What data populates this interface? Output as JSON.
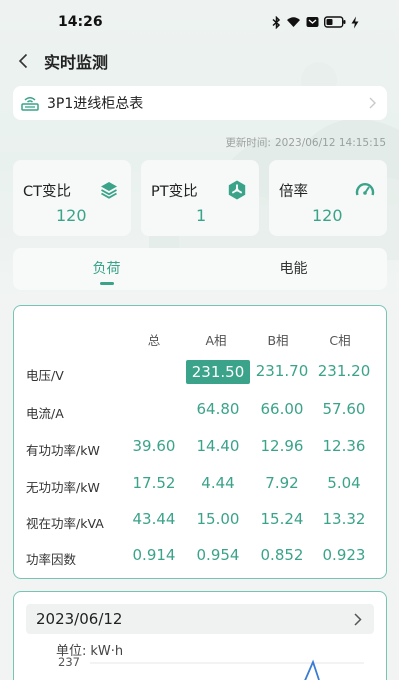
{
  "status_bar": {
    "time": "14:26",
    "icons": [
      "bluetooth-icon",
      "wifi-icon",
      "notification-icon",
      "battery-icon",
      "charging-icon"
    ]
  },
  "header": {
    "title": "实时监测"
  },
  "device": {
    "name": "3P1进线柜总表"
  },
  "update": {
    "label": "更新时间:",
    "value": "2023/06/12 14:15:15"
  },
  "ratios": [
    {
      "label": "CT变比",
      "value": "120",
      "icon": "layers-icon"
    },
    {
      "label": "PT变比",
      "value": "1",
      "icon": "fan-icon"
    },
    {
      "label": "倍率",
      "value": "120",
      "icon": "gauge-icon"
    }
  ],
  "tabs": [
    {
      "label": "负荷",
      "active": true
    },
    {
      "label": "电能",
      "active": false
    }
  ],
  "table": {
    "columns": [
      "总",
      "A相",
      "B相",
      "C相"
    ],
    "rows": [
      {
        "label": "电压/V",
        "values": [
          "",
          "231.50",
          "231.70",
          "231.20"
        ]
      },
      {
        "label": "电流/A",
        "values": [
          "",
          "64.80",
          "66.00",
          "57.60"
        ]
      },
      {
        "label": "有功功率/kW",
        "values": [
          "39.60",
          "14.40",
          "12.96",
          "12.36"
        ]
      },
      {
        "label": "无功功率/kW",
        "values": [
          "17.52",
          "4.44",
          "7.92",
          "5.04"
        ]
      },
      {
        "label": "视在功率/kVA",
        "values": [
          "43.44",
          "15.00",
          "15.24",
          "13.32"
        ]
      },
      {
        "label": "功率因数",
        "values": [
          "0.914",
          "0.954",
          "0.852",
          "0.923"
        ]
      }
    ],
    "highlighted_cell": "231.50"
  },
  "energy": {
    "date": "2023/06/12",
    "unit_label": "单位:",
    "unit_value": "kW·h",
    "y_top_tick": "237"
  },
  "colors": {
    "accent": "#3aa38a",
    "panel_border": "#78c4b2",
    "background": "#f1f4f3"
  }
}
